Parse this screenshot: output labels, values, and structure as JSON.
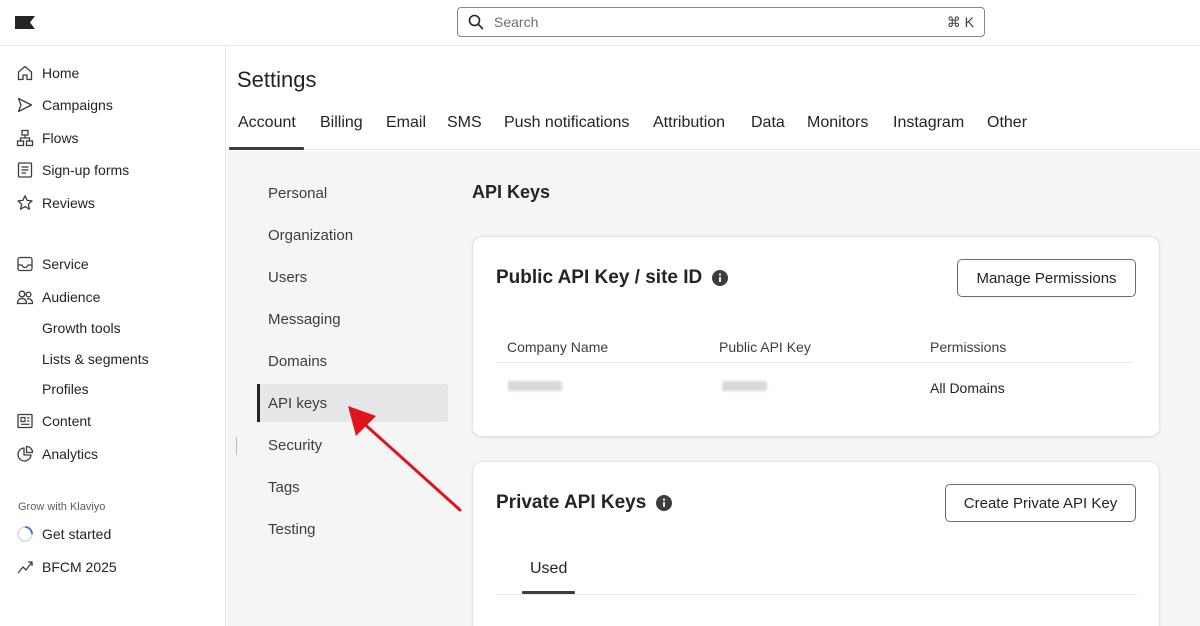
{
  "search": {
    "placeholder": "Search",
    "shortcut": "⌘ K"
  },
  "sidebar": {
    "items": [
      {
        "label": "Home",
        "icon": "home-icon"
      },
      {
        "label": "Campaigns",
        "icon": "send-icon"
      },
      {
        "label": "Flows",
        "icon": "flows-icon"
      },
      {
        "label": "Sign-up forms",
        "icon": "form-icon"
      },
      {
        "label": "Reviews",
        "icon": "star-icon"
      },
      {
        "label": "Service",
        "icon": "inbox-icon"
      },
      {
        "label": "Audience",
        "icon": "audience-icon"
      },
      {
        "label": "Content",
        "icon": "content-icon"
      },
      {
        "label": "Analytics",
        "icon": "analytics-icon"
      }
    ],
    "audience_sub": [
      "Growth tools",
      "Lists & segments",
      "Profiles"
    ],
    "caption": "Grow with Klaviyo",
    "get_started": "Get started",
    "bfcm": "BFCM 2025"
  },
  "page": {
    "title": "Settings"
  },
  "tabs": [
    "Account",
    "Billing",
    "Email",
    "SMS",
    "Push notifications",
    "Attribution",
    "Data",
    "Monitors",
    "Instagram",
    "Other"
  ],
  "subnav": [
    "Personal",
    "Organization",
    "Users",
    "Messaging",
    "Domains",
    "API keys",
    "Security",
    "Tags",
    "Testing"
  ],
  "main": {
    "section_title": "API Keys",
    "public_card": {
      "title": "Public API Key / site ID",
      "button": "Manage Permissions",
      "columns": [
        "Company Name",
        "Public API Key",
        "Permissions"
      ],
      "row_permissions": "All Domains"
    },
    "private_card": {
      "title": "Private API Keys",
      "button": "Create Private API Key",
      "tab": "Used"
    }
  },
  "colors": {
    "annotation_arrow": "#e0141b",
    "active_bg": "#e5e6e8",
    "text": "#232426"
  }
}
